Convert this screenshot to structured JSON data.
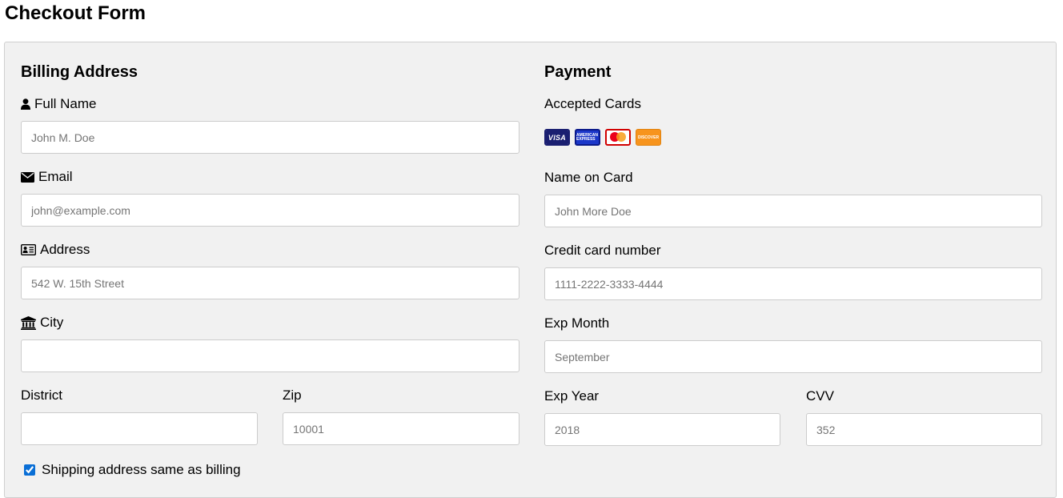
{
  "page": {
    "title": "Checkout Form"
  },
  "billing": {
    "title": "Billing Address",
    "full_name": {
      "label": "Full Name",
      "placeholder": "John M. Doe",
      "value": ""
    },
    "email": {
      "label": "Email",
      "placeholder": "john@example.com",
      "value": ""
    },
    "address": {
      "label": "Address",
      "placeholder": "542 W. 15th Street",
      "value": ""
    },
    "city": {
      "label": "City",
      "placeholder": "",
      "value": ""
    },
    "district": {
      "label": "District",
      "placeholder": "",
      "value": ""
    },
    "zip": {
      "label": "Zip",
      "placeholder": "10001",
      "value": ""
    },
    "same_as_billing": {
      "label": "Shipping address same as billing",
      "checked": true
    }
  },
  "payment": {
    "title": "Payment",
    "accepted_cards_label": "Accepted Cards",
    "cards": [
      {
        "name": "visa-icon",
        "text": "VISA",
        "color": "#1a1f71"
      },
      {
        "name": "amex-icon",
        "text": "AMERICAN EXPRESS",
        "color": "#1b37c9"
      },
      {
        "name": "mastercard-icon",
        "text": "",
        "color": "#d10000"
      },
      {
        "name": "discover-icon",
        "text": "DISCOVER",
        "color": "#f7941d"
      }
    ],
    "name_on_card": {
      "label": "Name on Card",
      "placeholder": "John More Doe",
      "value": ""
    },
    "card_number": {
      "label": "Credit card number",
      "placeholder": "1111-2222-3333-4444",
      "value": ""
    },
    "exp_month": {
      "label": "Exp Month",
      "placeholder": "September",
      "value": ""
    },
    "exp_year": {
      "label": "Exp Year",
      "placeholder": "2018",
      "value": ""
    },
    "cvv": {
      "label": "CVV",
      "placeholder": "352",
      "value": ""
    }
  },
  "icons": {
    "full_name": "user-icon",
    "email": "envelope-icon",
    "address": "address-card-icon",
    "city": "institution-icon"
  },
  "colors": {
    "panel_bg": "#f1f1f1",
    "checkbox_accent": "#0a6fd6"
  }
}
